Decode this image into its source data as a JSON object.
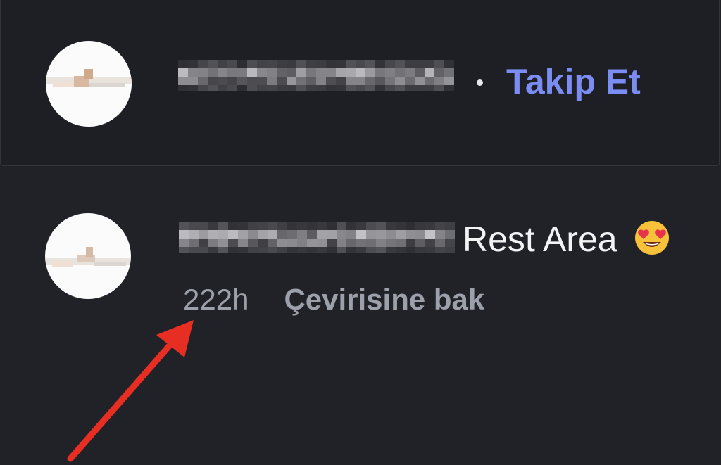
{
  "follow_row": {
    "separator": "•",
    "follow_label": "Takip Et"
  },
  "comment": {
    "text": "Rest Area",
    "emoji": "heart-eyes-emoji",
    "timestamp": "222h",
    "translate_label": "Çevirisine bak"
  },
  "colors": {
    "background": "#212227",
    "accent": "#7b8cf3",
    "annotation_arrow": "#e62e23"
  }
}
